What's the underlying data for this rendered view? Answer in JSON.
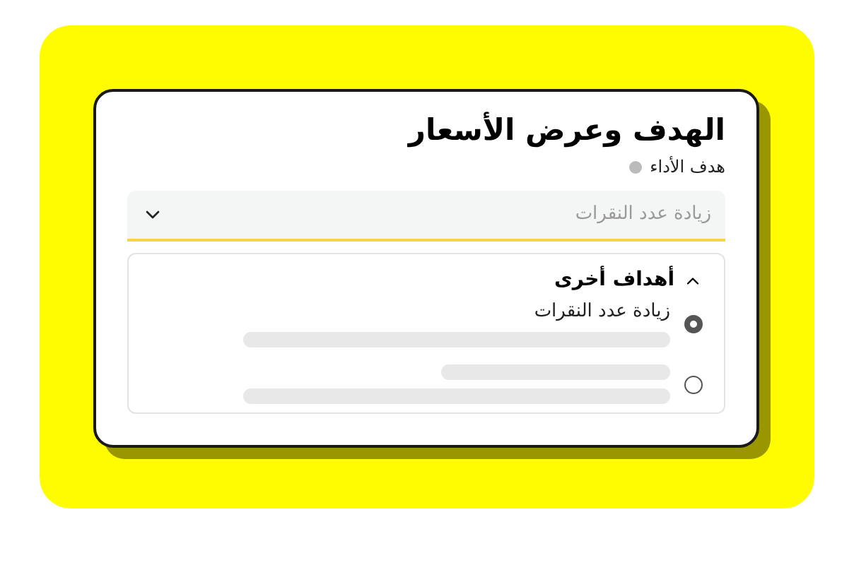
{
  "title": "الهدف وعرض الأسعار",
  "subtitle": "هدف الأداء",
  "dropdown": {
    "placeholder": "زيادة عدد النقرات"
  },
  "other_goals": {
    "title": "أهداف أخرى",
    "expanded": true,
    "options": [
      {
        "label": "زيادة عدد النقرات",
        "selected": true
      },
      {
        "selected": false
      }
    ]
  }
}
